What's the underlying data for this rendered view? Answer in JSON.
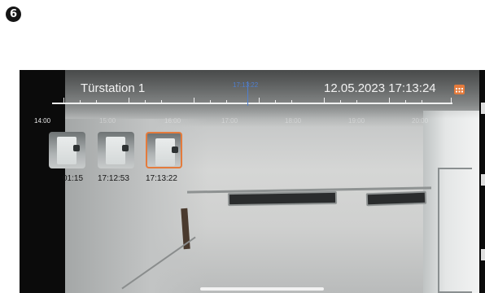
{
  "step_badge": "6",
  "header": {
    "station_name": "Türstation 1",
    "datetime": "12.05.2023 17:13:24",
    "calendar_icon": "calendar-icon",
    "accent_color": "#e47b3c"
  },
  "timeline": {
    "cursor_time": "17:13:22",
    "cursor_color": "#4f7fd0",
    "hour_labels": [
      "14:00",
      "15:00",
      "16:00",
      "17:00",
      "18:00",
      "19:00",
      "20:00"
    ]
  },
  "snapshots": [
    {
      "time": "01:15"
    },
    {
      "time": "17:12:53"
    },
    {
      "time": "17:13:22",
      "selected": true
    }
  ]
}
